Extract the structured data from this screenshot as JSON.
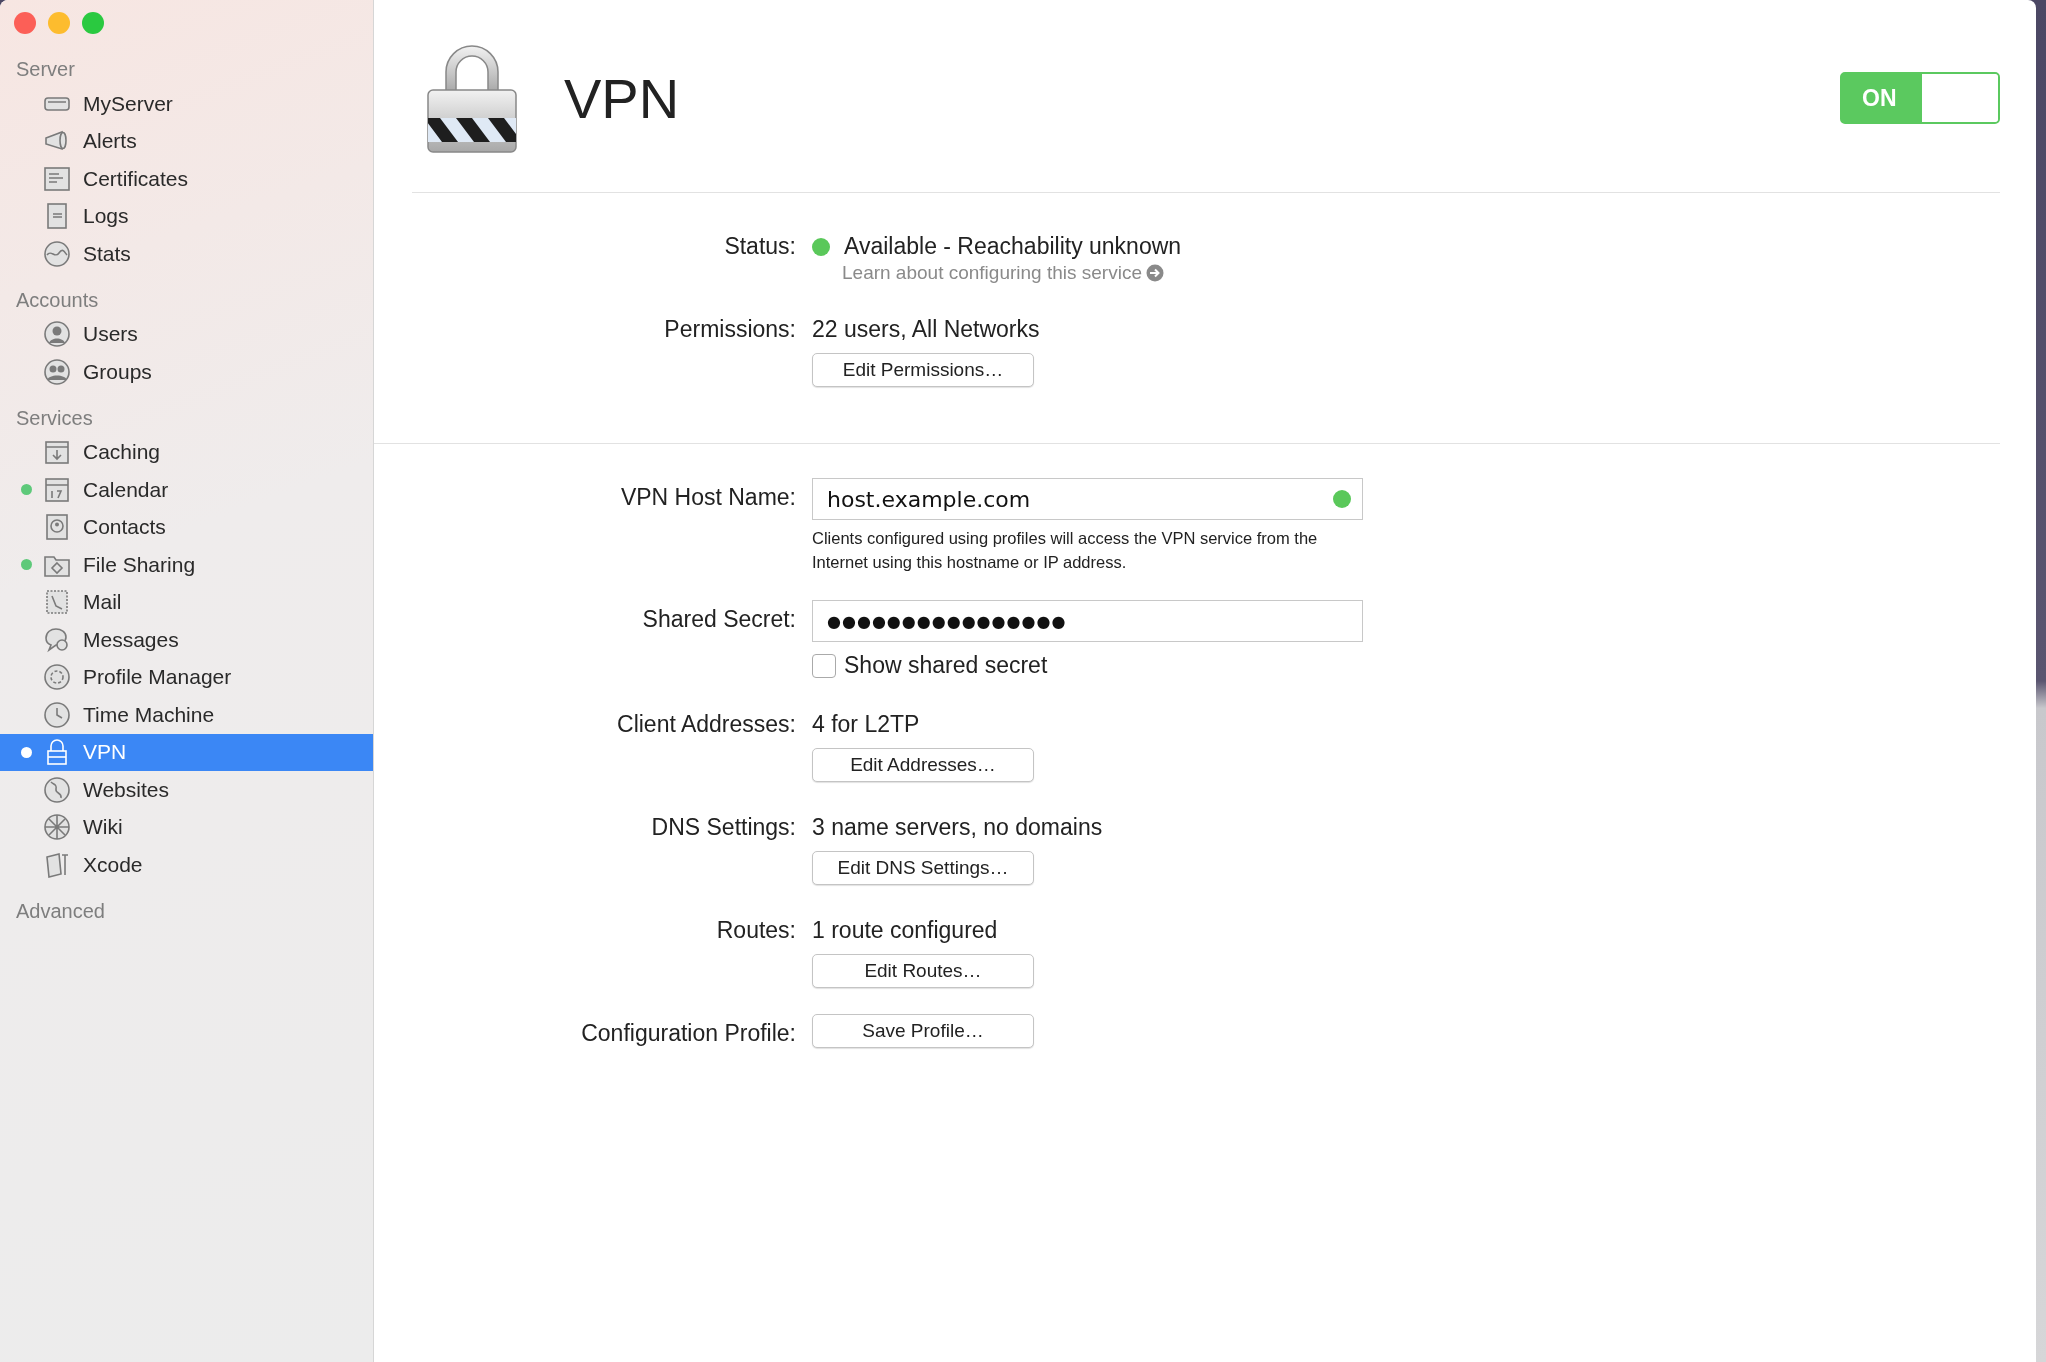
{
  "sidebar": {
    "sections": [
      {
        "title": "Server",
        "items": [
          {
            "label": "MyServer",
            "running": false,
            "selected": false
          },
          {
            "label": "Alerts",
            "running": false,
            "selected": false
          },
          {
            "label": "Certificates",
            "running": false,
            "selected": false
          },
          {
            "label": "Logs",
            "running": false,
            "selected": false
          },
          {
            "label": "Stats",
            "running": false,
            "selected": false
          }
        ]
      },
      {
        "title": "Accounts",
        "items": [
          {
            "label": "Users",
            "running": false,
            "selected": false
          },
          {
            "label": "Groups",
            "running": false,
            "selected": false
          }
        ]
      },
      {
        "title": "Services",
        "items": [
          {
            "label": "Caching",
            "running": false,
            "selected": false
          },
          {
            "label": "Calendar",
            "running": true,
            "selected": false
          },
          {
            "label": "Contacts",
            "running": false,
            "selected": false
          },
          {
            "label": "File Sharing",
            "running": true,
            "selected": false
          },
          {
            "label": "Mail",
            "running": false,
            "selected": false
          },
          {
            "label": "Messages",
            "running": false,
            "selected": false
          },
          {
            "label": "Profile Manager",
            "running": false,
            "selected": false
          },
          {
            "label": "Time Machine",
            "running": false,
            "selected": false
          },
          {
            "label": "VPN",
            "running": true,
            "selected": true
          },
          {
            "label": "Websites",
            "running": false,
            "selected": false
          },
          {
            "label": "Wiki",
            "running": false,
            "selected": false
          },
          {
            "label": "Xcode",
            "running": false,
            "selected": false
          }
        ]
      },
      {
        "title": "Advanced"
      }
    ]
  },
  "header": {
    "title": "VPN",
    "toggle": {
      "label": "ON",
      "on": true
    }
  },
  "form": {
    "sections": [
      [
        {
          "kind": "status",
          "label": "Status:",
          "value": "Available - Reachability unknown",
          "color": "#5ac85a",
          "link": "Learn about configuring this service"
        },
        {
          "kind": "value_button",
          "label": "Permissions:",
          "value": "22 users, All Networks",
          "button": "Edit Permissions…"
        }
      ],
      [
        {
          "kind": "field",
          "label": "VPN Host Name:",
          "value": "host.example.com",
          "valid": true,
          "hint": "Clients configured using profiles will access the VPN service from the Internet using this hostname or IP address."
        },
        {
          "kind": "secret",
          "label": "Shared Secret:",
          "value": "●●●●●●●●●●●●●●●●",
          "checkbox": {
            "label": "Show shared secret",
            "checked": false
          }
        },
        {
          "kind": "value_button",
          "label": "Client Addresses:",
          "value": "4 for L2TP",
          "button": "Edit Addresses…"
        },
        {
          "kind": "value_button",
          "label": "DNS Settings:",
          "value": "3 name servers, no domains",
          "button": "Edit DNS Settings…"
        },
        {
          "kind": "value_button",
          "label": "Routes:",
          "value": "1 route configured",
          "button": "Edit Routes…"
        },
        {
          "kind": "button",
          "label": "Configuration Profile:",
          "button": "Save Profile…"
        }
      ]
    ]
  }
}
